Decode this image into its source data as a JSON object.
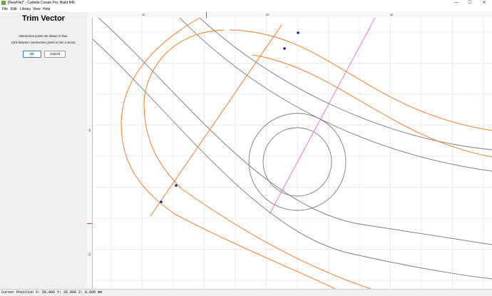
{
  "window": {
    "title": "[NewFile]* - Carbide Create Pro, Build 845",
    "minimize_glyph": "—",
    "maximize_glyph": "☐",
    "close_glyph": "✕"
  },
  "menu": [
    "File",
    "Edit",
    "Library",
    "View",
    "Help"
  ],
  "panel": {
    "title": "Trim Vector",
    "hint1": "Intersection points are shown in blue.",
    "hint2": "Click between intersection points to trim a vector.",
    "ok_label": "OK",
    "cancel_label": "Cancel"
  },
  "rulers": {
    "top_labels": [
      "40",
      "60",
      "80"
    ],
    "left_labels": [
      "40",
      "20"
    ]
  },
  "status": {
    "text": "Cursor Position X: 50.000 Y: 35.000 Z: 0.000 mm"
  },
  "colors": {
    "orange_vector": "#f07d2e",
    "gray_vector": "#7a7a7a",
    "trim_line": "#ee66ee",
    "intersection_point": "#1a1aa8",
    "grid": "#e4e4e4",
    "marker": "#d43b3b"
  }
}
